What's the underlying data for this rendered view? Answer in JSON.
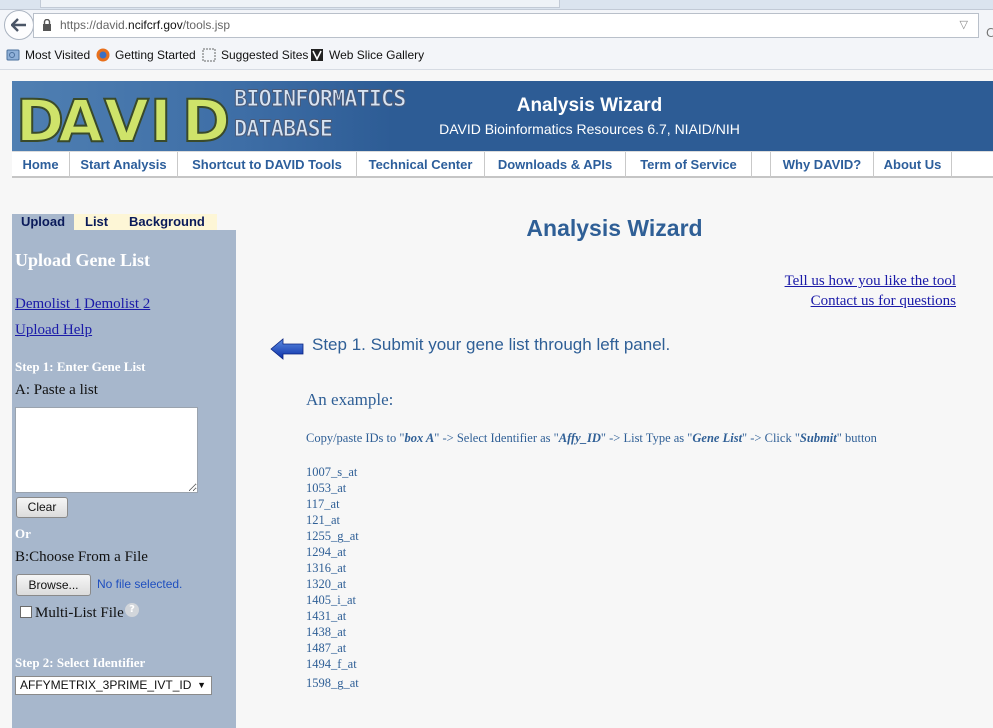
{
  "browser": {
    "url_prefix": "https://david.",
    "url_domain": "ncifcrf.gov",
    "url_path": "/tools.jsp",
    "bookmarks": [
      "Most Visited",
      "Getting Started",
      "Suggested Sites",
      "Web Slice Gallery"
    ]
  },
  "banner": {
    "logo_letters": [
      "D",
      "A",
      "V",
      "I",
      "D"
    ],
    "logo_line1": "BIOINFORMATICS",
    "logo_line2": "DATABASE",
    "title": "Analysis Wizard",
    "subtitle": "DAVID Bioinformatics Resources 6.7, NIAID/NIH"
  },
  "menu": [
    "Home",
    "Start Analysis",
    "Shortcut to DAVID Tools",
    "Technical Center",
    "Downloads & APIs",
    "Term of Service",
    "Why DAVID?",
    "About Us"
  ],
  "sidebar": {
    "tabs": [
      "Upload",
      "List",
      "Background"
    ],
    "title": "Upload Gene List",
    "demolist1": "Demolist 1",
    "demolist2": "Demolist 2",
    "upload_help": "Upload Help",
    "step1": "Step 1: Enter Gene List",
    "paste_label": "A: Paste a list",
    "paste_value": "",
    "clear": "Clear",
    "or": "Or",
    "file_label": "B:Choose From a File",
    "browse": "Browse...",
    "no_file": "No file selected.",
    "multi_list": "Multi-List File",
    "help_mark": "?",
    "step2": "Step 2: Select Identifier",
    "identifier": "AFFYMETRIX_3PRIME_IVT_ID"
  },
  "main": {
    "title": "Analysis Wizard",
    "link_feedback": "Tell us how you like the tool",
    "link_contact": "Contact us for questions",
    "step1": "Step 1. Submit your gene list through left panel.",
    "example_label": "An example:",
    "instr_1": "Copy/paste IDs to \"",
    "instr_box": "box A",
    "instr_2": "\" -> Select Identifier as  \"",
    "instr_affy": "Affy_ID",
    "instr_3": "\" -> List Type as \"",
    "instr_gene": "Gene List",
    "instr_4": "\" -> Click \"",
    "instr_submit": "Submit",
    "instr_5": "\" button",
    "ids": [
      "1007_s_at",
      "1053_at",
      "117_at",
      "121_at",
      "1255_g_at",
      "1294_at",
      "1316_at",
      "1320_at",
      "1405_i_at",
      "1431_at",
      "1438_at",
      "1487_at",
      "1494_f_at"
    ],
    "last_id": "1598_g_at"
  }
}
